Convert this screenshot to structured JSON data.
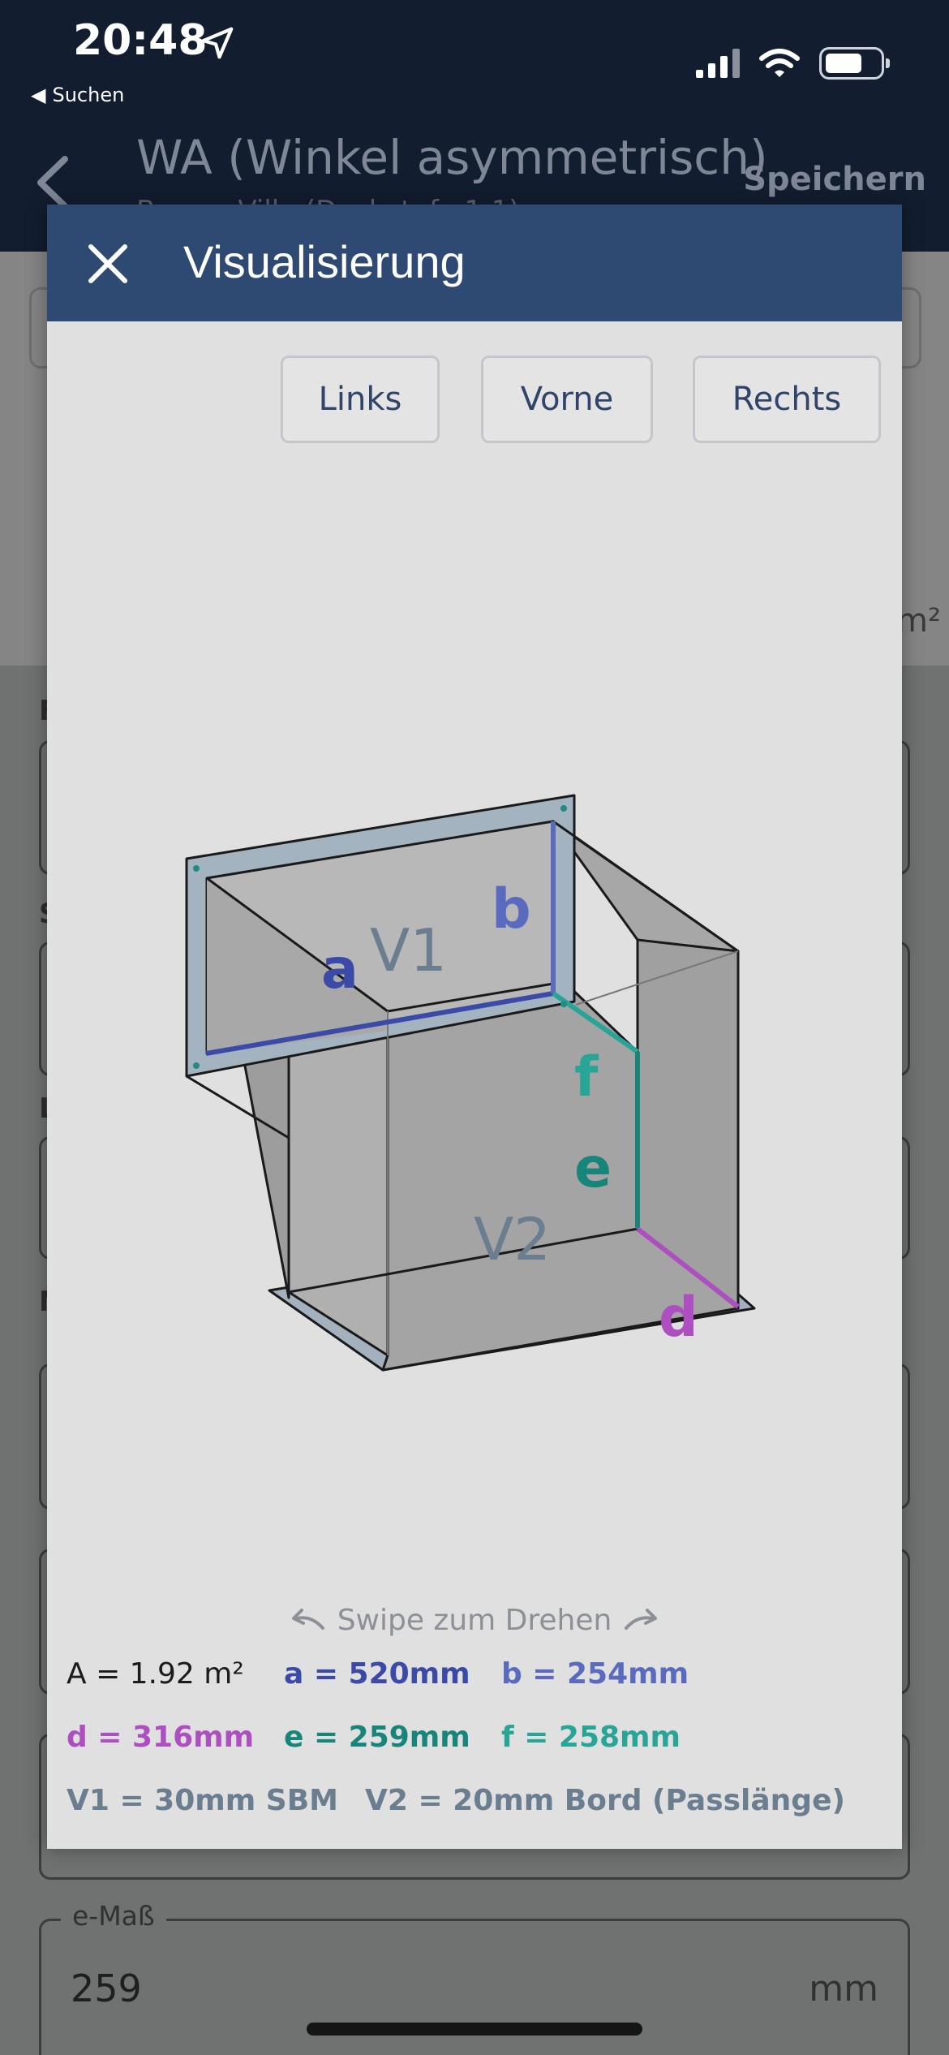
{
  "status": {
    "time": "20:48",
    "back_app": "Suchen"
  },
  "nav": {
    "title": "WA (Winkel asymmetrisch)",
    "subtitle": "Besser Villa (Dachstufe 1:1)",
    "save_label": "Speichern"
  },
  "background": {
    "label_1": "F",
    "label_2": "S",
    "label_3": "L",
    "label_4": "N",
    "unit_edge": "m²",
    "field": {
      "legend": "e-Maß",
      "value": "259",
      "unit": "mm"
    }
  },
  "modal": {
    "title": "Visualisierung",
    "views": [
      {
        "label": "Links"
      },
      {
        "label": "Vorne"
      },
      {
        "label": "Rechts"
      }
    ],
    "diagram": {
      "labels": {
        "a": "a",
        "b": "b",
        "d": "d",
        "e": "e",
        "f": "f",
        "v1": "V1",
        "v2": "V2"
      },
      "colors": {
        "a": "#3b4aa6",
        "b": "#5a6bbf",
        "d": "#ad4fc0",
        "e": "#17857a",
        "f": "#28a596",
        "v": "#6a7e90"
      }
    },
    "swipe_hint": "Swipe zum Drehen",
    "measurements": {
      "area": "A = 1.92 m²",
      "a": "a = 520mm",
      "b": "b = 254mm",
      "d": "d = 316mm",
      "e": "e = 259mm",
      "f": "f = 258mm",
      "v1": "V1 = 30mm SBM",
      "v2": "V2 = 20mm Bord (Passlänge)"
    }
  }
}
